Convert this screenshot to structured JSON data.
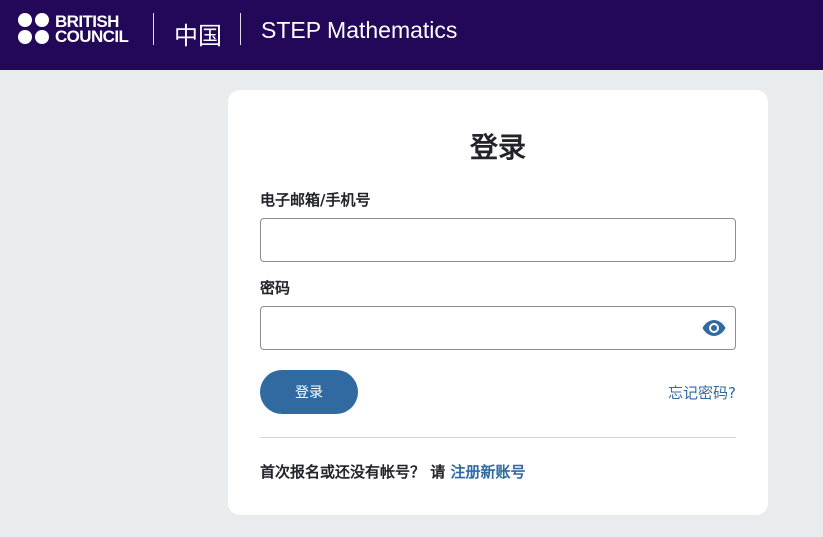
{
  "header": {
    "logo_line1": "BRITISH",
    "logo_line2": "COUNCIL",
    "region": "中国",
    "site_title": "STEP Mathematics",
    "background_color": "#23085a"
  },
  "login": {
    "title": "登录",
    "email_label": "电子邮箱/手机号",
    "email_value": "",
    "email_placeholder": "",
    "password_label": "密码",
    "password_value": "",
    "password_placeholder": "",
    "show_password_icon": "eye-icon",
    "submit_label": "登录",
    "forgot_label": "忘记密码?",
    "register_prompt": "首次报名或还没有帐号？ 请",
    "register_link": "注册新账号",
    "accent_color": "#306aa0"
  }
}
